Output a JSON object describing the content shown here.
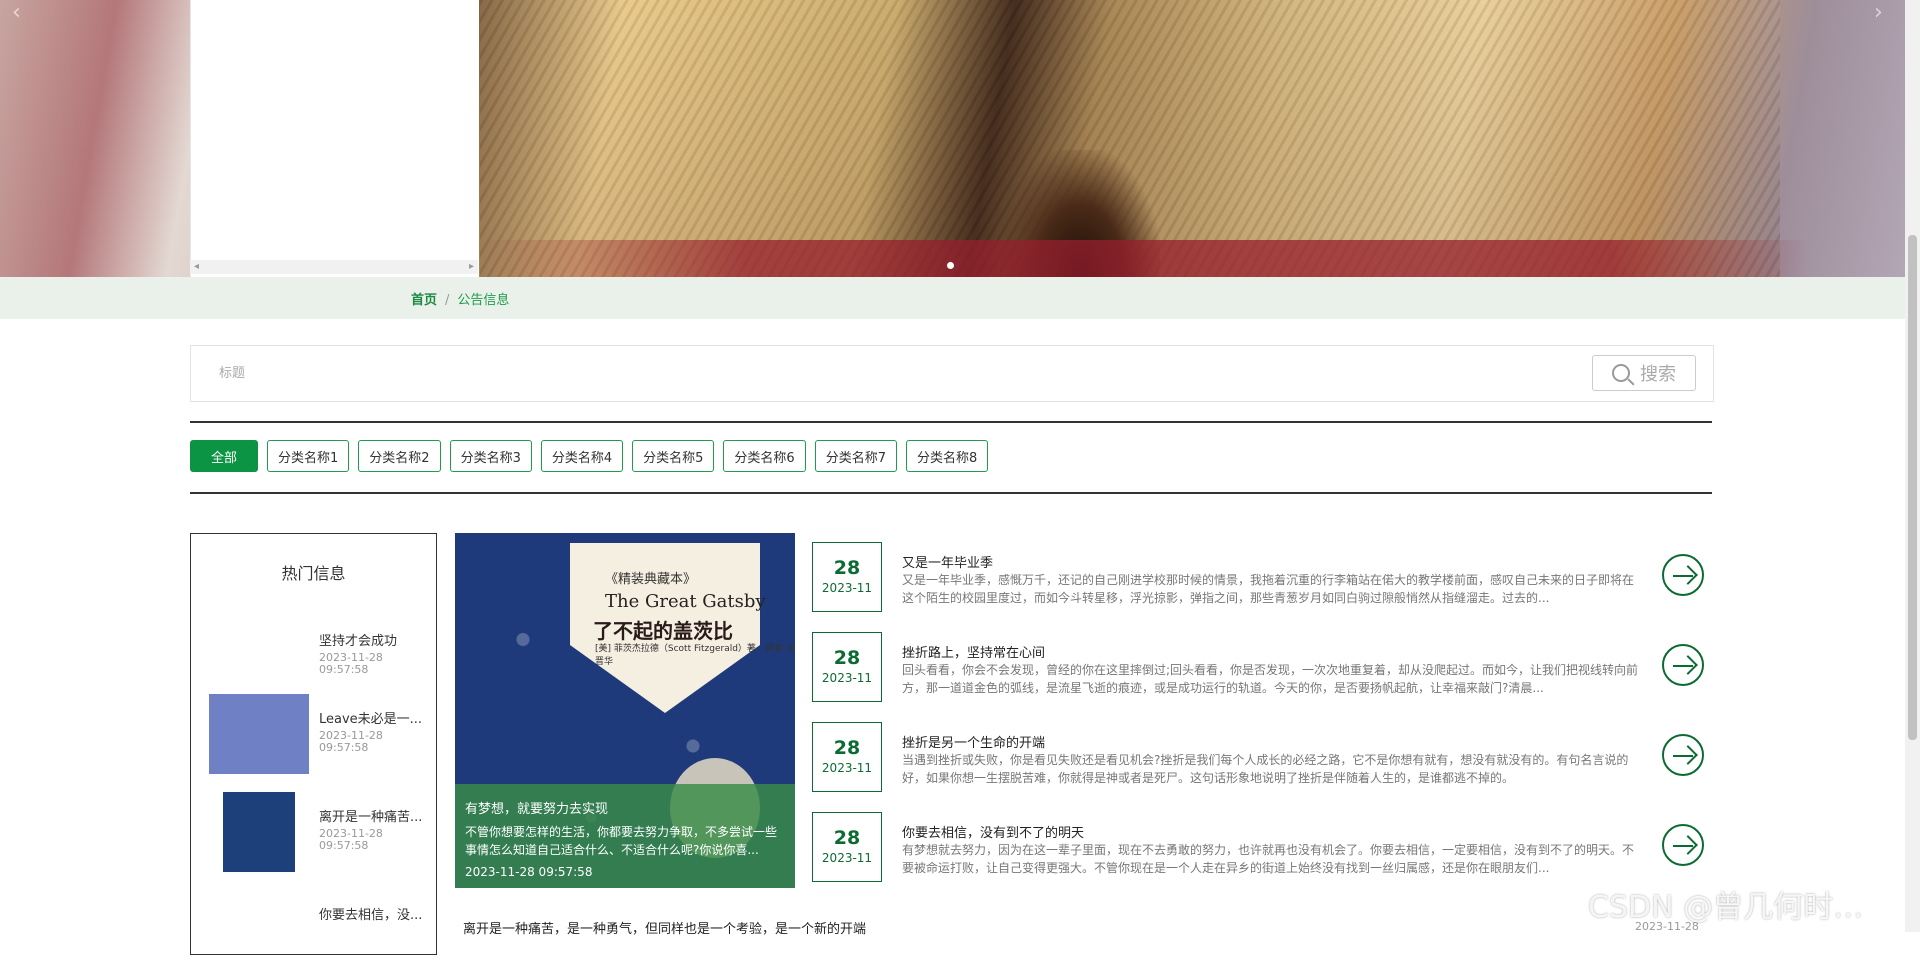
{
  "carousel": {
    "prev_icon": "chevron-left-icon",
    "next_icon": "chevron-right-icon",
    "dots": 1
  },
  "breadcrumb": {
    "home": "首页",
    "separator": "/",
    "current": "公告信息"
  },
  "search": {
    "placeholder": "标题",
    "button_label": "搜索"
  },
  "categories": [
    "全部",
    "分类名称1",
    "分类名称2",
    "分类名称3",
    "分类名称4",
    "分类名称5",
    "分类名称6",
    "分类名称7",
    "分类名称8"
  ],
  "hot": {
    "title": "热门信息",
    "items": [
      {
        "name": "坚持才会成功",
        "date": "2023-11-28 09:57:58",
        "thumb": false
      },
      {
        "name": "Leave未必是一...",
        "date": "2023-11-28 09:57:58",
        "thumb": true,
        "color": "#6f80c4"
      },
      {
        "name": "离开是一种痛苦...",
        "date": "2023-11-28 09:57:58",
        "thumb": true,
        "color": "#1d3f7a"
      },
      {
        "name": "你要去相信，没...",
        "date": "",
        "thumb": false
      }
    ]
  },
  "feature": {
    "cover_series": "《精装典藏本》",
    "cover_en": "The Great Gatsby",
    "cover_zh": "了不起的盖茨比",
    "cover_authors": "[美] 菲茨杰拉德（Scott Fitzgerald）著　译者 王晋华",
    "caption_title": "有梦想，就要努力去实现",
    "caption_desc": "不管你想要怎样的生活，你都要去努力争取，不多尝试一些事情怎么知道自己适合什么、不适合什么呢?你说你喜...",
    "caption_time": "2023-11-28 09:57:58"
  },
  "news": [
    {
      "day": "28",
      "ym": "2023-11",
      "title": "又是一年毕业季",
      "desc": "又是一年毕业季，感慨万千，还记的自己刚进学校那时候的情景，我拖着沉重的行李箱站在偌大的教学楼前面，感叹自己未来的日子即将在这个陌生的校园里度过，而如今斗转星移，浮光掠影，弹指之间，那些青葱岁月如同白驹过隙般悄然从指缝溜走。过去的..."
    },
    {
      "day": "28",
      "ym": "2023-11",
      "title": "挫折路上，坚持常在心间",
      "desc": "回头看看，你会不会发现，曾经的你在这里摔倒过;回头看看，你是否发现，一次次地重复着，却从没爬起过。而如今，让我们把视线转向前方，那一道道金色的弧线，是流星飞逝的痕迹，或是成功运行的轨道。今天的你，是否要扬帆起航，让幸福来敲门?清晨..."
    },
    {
      "day": "28",
      "ym": "2023-11",
      "title": "挫折是另一个生命的开端",
      "desc": "当遇到挫折或失败，你是看见失败还是看见机会?挫折是我们每个人成长的必经之路，它不是你想有就有，想没有就没有的。有句名言说的好，如果你想一生摆脱苦难，你就得是神或者是死尸。这句话形象地说明了挫折是伴随着人生的，是谁都逃不掉的。"
    },
    {
      "day": "28",
      "ym": "2023-11",
      "title": "你要去相信，没有到不了的明天",
      "desc": "有梦想就去努力，因为在这一辈子里面，现在不去勇敢的努力，也许就再也没有机会了。你要去相信，一定要相信，没有到不了的明天。不要被命运打败，让自己变得更强大。不管你现在是一个人走在异乡的街道上始终没有找到一丝归属感，还是你在眼朋友们..."
    }
  ],
  "bottom": {
    "title": "离开是一种痛苦，是一种勇气，但同样也是一个考验，是一个新的开端",
    "date": "2023-11-28"
  },
  "watermark": "CSDN @曾几何时…"
}
